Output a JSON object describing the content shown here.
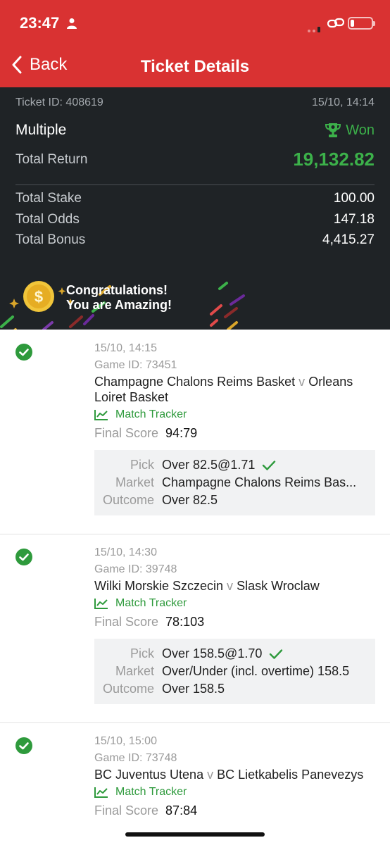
{
  "status_bar": {
    "time": "23:47"
  },
  "nav": {
    "back_label": "Back",
    "title": "Ticket Details"
  },
  "summary": {
    "ticket_id": "Ticket ID: 408619",
    "datetime": "15/10, 14:14",
    "type": "Multiple",
    "status": "Won",
    "total_return_label": "Total Return",
    "total_return": "19,132.82",
    "stake_label": "Total Stake",
    "stake": "100.00",
    "odds_label": "Total Odds",
    "odds": "147.18",
    "bonus_label": "Total Bonus",
    "bonus": "4,415.27",
    "congrats_line1": "Congratulations!",
    "congrats_line2": "You are Amazing!"
  },
  "labels": {
    "match_tracker": "Match Tracker",
    "final_score": "Final Score",
    "pick": "Pick",
    "market": "Market",
    "outcome": "Outcome",
    "versus": "v"
  },
  "bets": [
    {
      "date": "15/10, 14:15",
      "game_id": "Game ID: 73451",
      "home": "Champagne Chalons Reims Basket",
      "away": "Orleans Loiret Basket",
      "final_score": "94:79",
      "pick": "Over 82.5@1.71",
      "market": "Champagne Chalons Reims Bas...",
      "outcome": "Over 82.5"
    },
    {
      "date": "15/10, 14:30",
      "game_id": "Game ID: 39748",
      "home": "Wilki Morskie Szczecin",
      "away": "Slask Wroclaw",
      "final_score": "78:103",
      "pick": "Over 158.5@1.70",
      "market": "Over/Under (incl. overtime) 158.5",
      "outcome": "Over 158.5"
    },
    {
      "date": "15/10, 15:00",
      "game_id": "Game ID: 73748",
      "home": "BC Juventus Utena",
      "away": "BC Lietkabelis Panevezys",
      "final_score": "87:84"
    }
  ],
  "colors": {
    "header_red": "#d93232",
    "summary_dark": "#1f2326",
    "win_green": "#3cb14a"
  },
  "icons": [
    "person-icon",
    "signal-icon",
    "link-icon",
    "battery-icon",
    "chevron-left-icon",
    "trophy-icon",
    "coin-icon",
    "check-circle-icon",
    "chart-line-icon",
    "checkmark-icon"
  ]
}
